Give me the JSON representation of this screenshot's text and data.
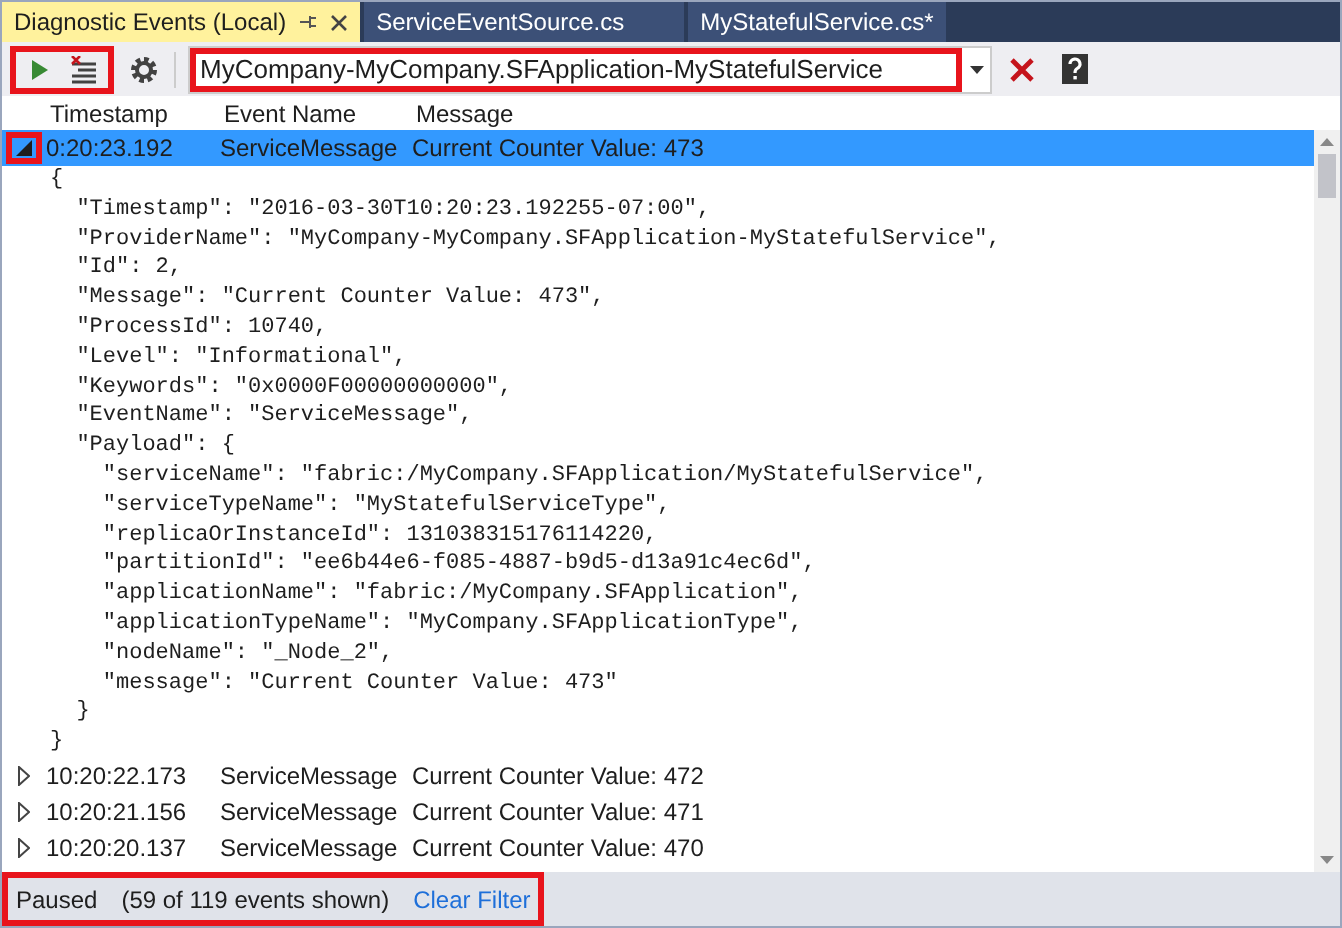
{
  "tabs": [
    {
      "label": "Diagnostic Events (Local)",
      "selected": true,
      "pinned": true
    },
    {
      "label": "ServiceEventSource.cs",
      "selected": false,
      "pinned": false
    },
    {
      "label": "MyStatefulService.cs*",
      "selected": false,
      "pinned": false
    }
  ],
  "toolbar": {
    "filter": {
      "value": "MyCompany-MyCompany.SFApplication-MyStatefulService"
    }
  },
  "table": {
    "columns": [
      "Timestamp",
      "Event Name",
      "Message"
    ],
    "rows": [
      {
        "timestamp": "0:20:23.192",
        "event_name": "ServiceMessage",
        "message": "Current Counter Value: 473",
        "expanded": true,
        "selected": true,
        "details": [
          "{",
          "  \"Timestamp\": \"2016-03-30T10:20:23.192255-07:00\",",
          "  \"ProviderName\": \"MyCompany-MyCompany.SFApplication-MyStatefulService\",",
          "  \"Id\": 2,",
          "  \"Message\": \"Current Counter Value: 473\",",
          "  \"ProcessId\": 10740,",
          "  \"Level\": \"Informational\",",
          "  \"Keywords\": \"0x0000F00000000000\",",
          "  \"EventName\": \"ServiceMessage\",",
          "  \"Payload\": {",
          "    \"serviceName\": \"fabric:/MyCompany.SFApplication/MyStatefulService\",",
          "    \"serviceTypeName\": \"MyStatefulServiceType\",",
          "    \"replicaOrInstanceId\": 131038315176114220,",
          "    \"partitionId\": \"ee6b44e6-f085-4887-b9d5-d13a91c4ec6d\",",
          "    \"applicationName\": \"fabric:/MyCompany.SFApplication\",",
          "    \"applicationTypeName\": \"MyCompany.SFApplicationType\",",
          "    \"nodeName\": \"_Node_2\",",
          "    \"message\": \"Current Counter Value: 473\"",
          "  }",
          "}"
        ]
      },
      {
        "timestamp": "10:20:22.173",
        "event_name": "ServiceMessage",
        "message": "Current Counter Value: 472",
        "expanded": false,
        "selected": false
      },
      {
        "timestamp": "10:20:21.156",
        "event_name": "ServiceMessage",
        "message": "Current Counter Value: 471",
        "expanded": false,
        "selected": false
      },
      {
        "timestamp": "10:20:20.137",
        "event_name": "ServiceMessage",
        "message": "Current Counter Value: 470",
        "expanded": false,
        "selected": false
      }
    ]
  },
  "status_bar": {
    "state": "Paused",
    "count": "(59 of 119 events shown)",
    "link": "Clear Filter"
  }
}
